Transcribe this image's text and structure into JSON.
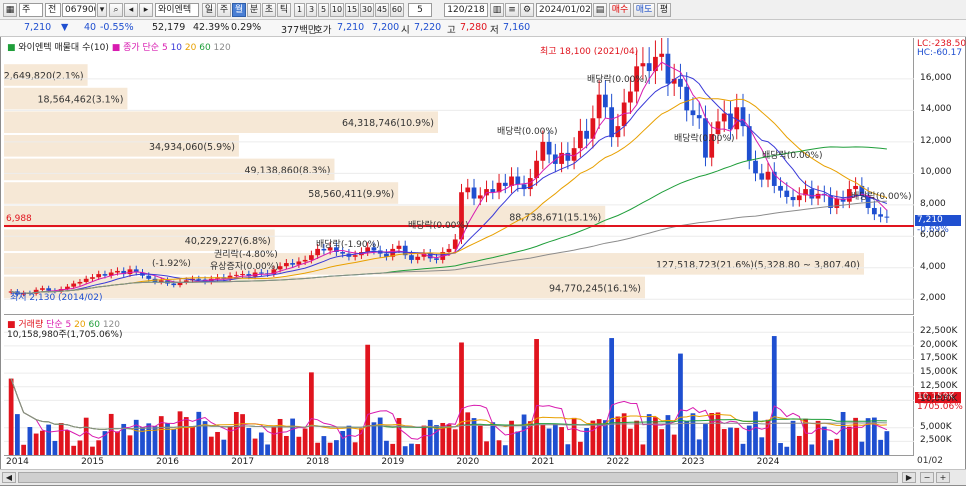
{
  "toolbar": {
    "market_select": "주",
    "code_mode": "전",
    "stock_code": "067900",
    "stock_name": "와이엔텍",
    "periods": [
      "일",
      "주",
      "월",
      "분",
      "초",
      "틱"
    ],
    "active_period": "월",
    "intervals": [
      "1",
      "3",
      "5",
      "10",
      "15",
      "30",
      "45",
      "60"
    ],
    "interval_value": "5",
    "count": "120/218",
    "date": "2024/01/02",
    "buy_label": "매수",
    "sell_label": "매도",
    "avg_label": "평"
  },
  "quote": {
    "price": "7,210",
    "down_mark": "▼",
    "change": "40",
    "change_pct": "-0.55%",
    "volume": "52,179",
    "vol_ratio": "42.39%",
    "turnover": "0.29%",
    "amount": "377백만",
    "hoga_label": "호가",
    "ask": "7,210",
    "bid": "7,200",
    "open_label": "시",
    "open": "7,220",
    "high_label": "고",
    "high": "7,280",
    "low_label": "저",
    "low": "7,160"
  },
  "price_panel": {
    "legend_title": "와이엔텍 매물대 수(10)",
    "legend_ma_label": "종가 단순",
    "legend_ma_periods": [
      "5",
      "10",
      "20",
      "60",
      "120"
    ],
    "legend_ma_colors": [
      "#d81bb0",
      "#3a3ad8",
      "#e8a000",
      "#1f9e3a",
      "#8c8c8c"
    ],
    "lc_label": "LC:-238.50",
    "hc_label": "HC:-60.17",
    "price_tag": "7,210",
    "price_tag_pct": "-0.69%",
    "ref_line_label": "6,988",
    "y_ticks": [
      "16,000",
      "14,000",
      "12,000",
      "10,000",
      "8,000",
      "6,000",
      "4,000",
      "2,000"
    ],
    "volume_profile": [
      {
        "label": "12,649,820(2.1%)"
      },
      {
        "label": "18,564,462(3.1%)"
      },
      {
        "label": "64,318,746(10.9%)"
      },
      {
        "label": "34,934,060(5.9%)"
      },
      {
        "label": "49,138,860(8.3%)"
      },
      {
        "label": "58,560,411(9.9%)"
      },
      {
        "label": "88,738,671(15.1%)"
      },
      {
        "label": "40,229,227(6.8%)"
      },
      {
        "label": "127,518,723(21.6%)(5,328.80 ~ 3,807.40)"
      },
      {
        "label": "94,770,245(16.1%)"
      }
    ],
    "annotations": {
      "high": "최고 18,100 (2021/04)",
      "low": "최저 2,130 (2014/02)",
      "dividend": "배당락(0.00%)",
      "dividend_neg": "배당락(-1.90%)",
      "pct_neg": "(-1.92%)",
      "rights": "권리락(-4.80%)",
      "paid_in": "유상증자(0.00%)"
    }
  },
  "volume_panel": {
    "legend_title": "거래량",
    "legend_ma_label": "단순",
    "legend_ma_periods": [
      "5",
      "20",
      "60",
      "120"
    ],
    "legend_value": "10,158,980주(1,705.06%)",
    "y_ticks": [
      "22,500K",
      "20,000K",
      "17,500K",
      "15,000K",
      "12,500K",
      "10,000K",
      "5,000K",
      "2,500K"
    ],
    "tag_value": "10,159K",
    "tag_pct": "1705.06%"
  },
  "x_axis": {
    "years": [
      "2014",
      "2015",
      "2016",
      "2017",
      "2018",
      "2019",
      "2020",
      "2021",
      "2022",
      "2023",
      "2024"
    ],
    "cursor_label": "01/02"
  },
  "chart_data": {
    "type": "candlestick",
    "x_unit": "month",
    "start": "2014-01",
    "closes": [
      2500,
      2300,
      2400,
      2350,
      2600,
      2700,
      2550,
      2500,
      2650,
      2800,
      3000,
      3100,
      3300,
      3400,
      3600,
      3500,
      3700,
      3800,
      3600,
      3900,
      3700,
      3500,
      3300,
      3100,
      3200,
      3000,
      2900,
      3100,
      3200,
      3300,
      3250,
      3100,
      3300,
      3400,
      3300,
      3500,
      3550,
      3600,
      3450,
      3700,
      3650,
      3600,
      3900,
      4100,
      4300,
      4200,
      4400,
      4500,
      4800,
      5200,
      5100,
      5300,
      5000,
      4900,
      4700,
      4800,
      5000,
      5300,
      5100,
      4900,
      4700,
      5200,
      5400,
      4800,
      4500,
      4700,
      4900,
      4600,
      4500,
      5000,
      5200,
      5800,
      8800,
      9100,
      8400,
      8600,
      9000,
      8800,
      9400,
      9200,
      9800,
      9300,
      9000,
      9700,
      10800,
      12000,
      11200,
      10600,
      11300,
      10800,
      11600,
      12700,
      12200,
      13500,
      15000,
      14200,
      12300,
      13000,
      14500,
      15200,
      16800,
      17000,
      16500,
      17400,
      17600,
      15700,
      16000,
      15500,
      14000,
      13700,
      13500,
      11000,
      12500,
      13300,
      13800,
      12800,
      14200,
      13000,
      10800,
      10000,
      9600,
      10100,
      9200,
      8900,
      8500,
      8300,
      8600,
      9000,
      8400,
      8700,
      8600,
      7800,
      8400,
      8200,
      9000,
      9200,
      8600,
      7800,
      7400,
      7250,
      7210
    ]
  }
}
